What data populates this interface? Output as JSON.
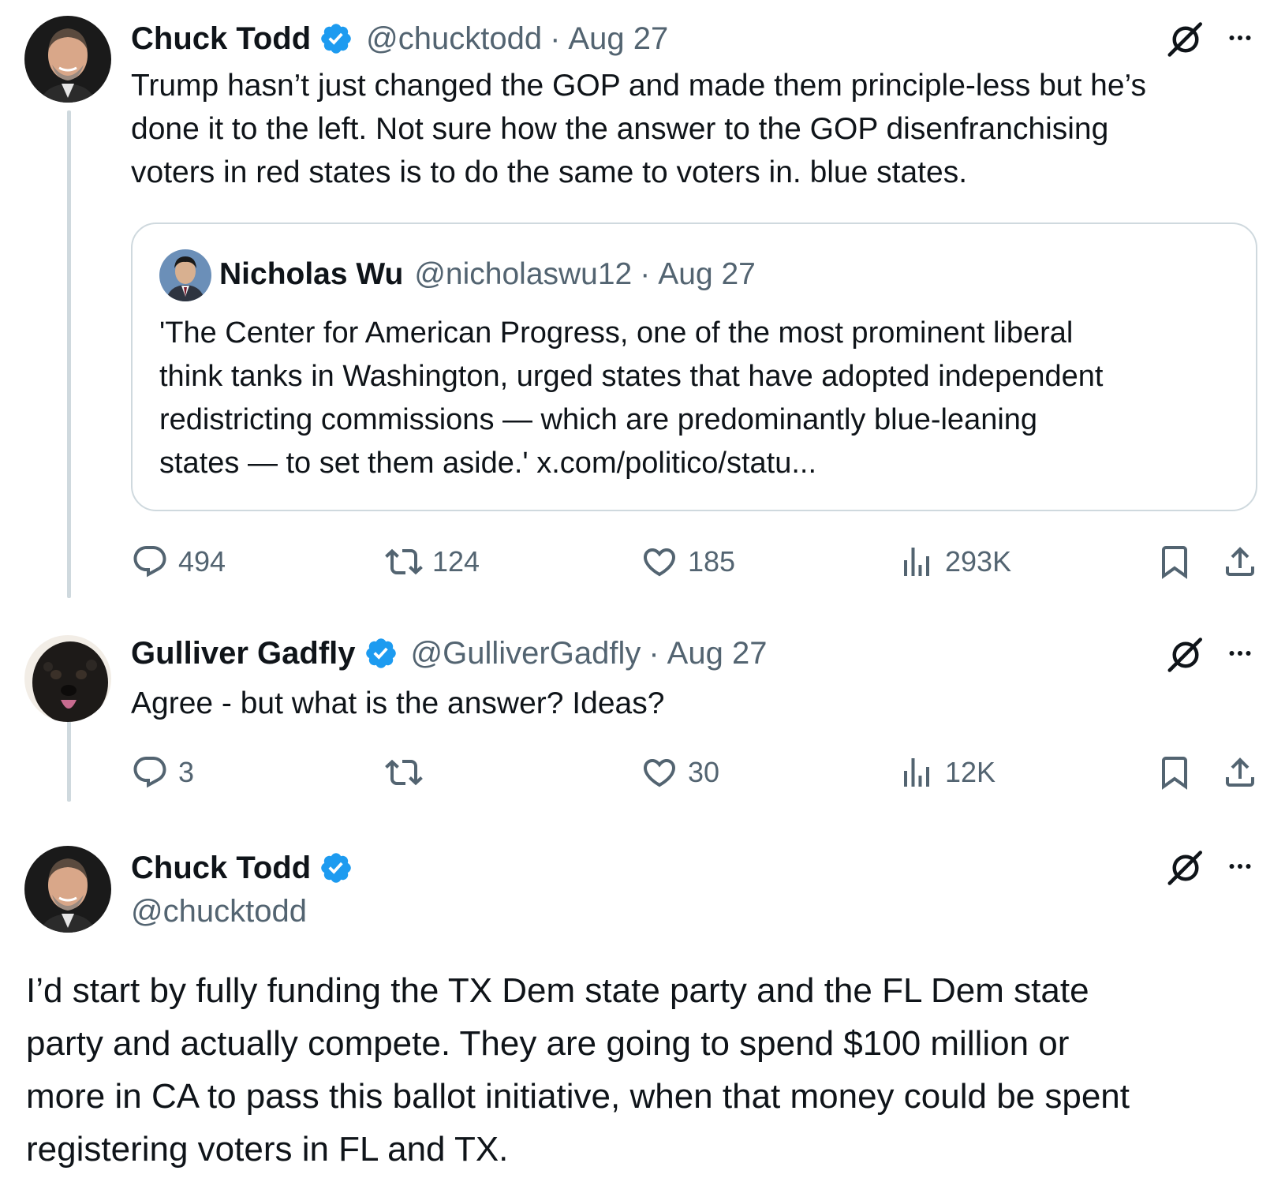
{
  "tweet1": {
    "name": "Chuck Todd",
    "handle": "@chucktodd",
    "separator": "·",
    "date": "Aug 27",
    "text_lines": [
      "Trump hasn’t just changed the GOP and made them principle-less but he’s",
      "done it to the left.  Not sure how the answer to the GOP disenfranchising",
      "voters in red states is to do the same to voters in. blue states."
    ],
    "quote": {
      "name": "Nicholas Wu",
      "handle": "@nicholaswu12",
      "separator": "·",
      "date": "Aug 27",
      "text_lines": [
        "'The Center for American Progress, one of the most prominent liberal",
        "think tanks in Washington, urged states that have adopted independent",
        "redistricting commissions — which are predominantly blue-leaning",
        "states — to set them aside.' x.com/politico/statu..."
      ]
    },
    "actions": {
      "replies": "494",
      "reposts": "124",
      "likes": "185",
      "views": "293K"
    }
  },
  "tweet2": {
    "name": "Gulliver Gadfly",
    "handle": "@GulliverGadfly",
    "separator": "·",
    "date": "Aug 27",
    "text": "Agree - but what is the answer?  Ideas?",
    "actions": {
      "replies": "3",
      "reposts": "",
      "likes": "30",
      "views": "12K"
    }
  },
  "tweet3": {
    "name": "Chuck Todd",
    "handle": "@chucktodd",
    "text_lines": [
      "I’d start by fully funding the TX Dem state party and the FL Dem state",
      "party and actually compete. They are going to spend $100 million or",
      "more in CA to pass this ballot initiative, when that money could be spent",
      "registering voters in FL and TX."
    ]
  },
  "icons": {
    "verified": "verified-badge-icon",
    "grok": "grok-icon",
    "more": "more-icon",
    "reply": "reply-icon",
    "repost": "repost-icon",
    "like": "like-icon",
    "views": "views-icon",
    "bookmark": "bookmark-icon",
    "share": "share-icon"
  },
  "colors": {
    "text": "#0f1419",
    "muted": "#536471",
    "verified": "#1d9bf0",
    "thread_line": "#cfd9de"
  }
}
